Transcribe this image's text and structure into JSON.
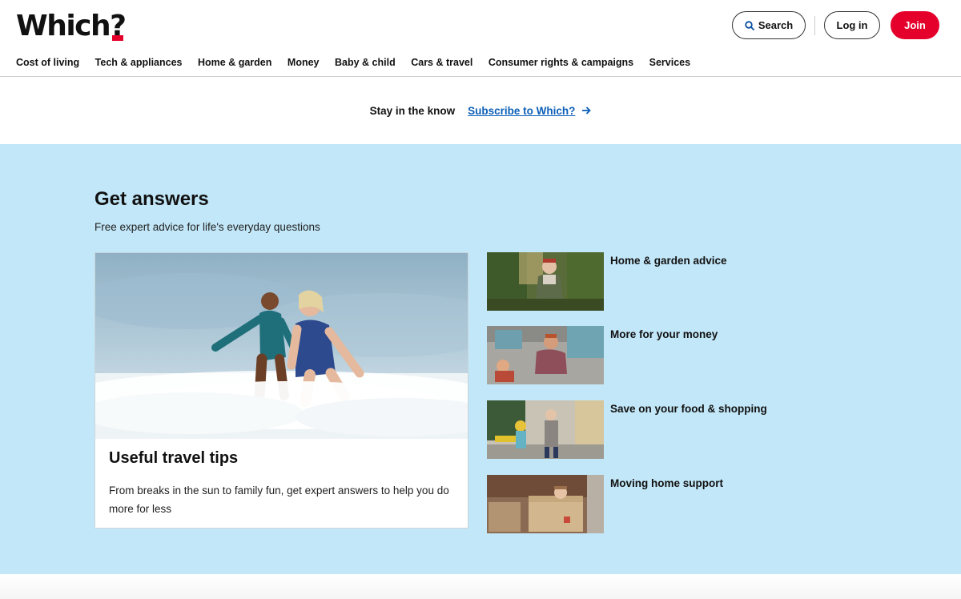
{
  "brand": {
    "name": "Which",
    "mark": "?",
    "accent": "#e4002b"
  },
  "header": {
    "search_label": "Search",
    "login_label": "Log in",
    "join_label": "Join"
  },
  "nav": [
    "Cost of living",
    "Tech & appliances",
    "Home & garden",
    "Money",
    "Baby & child",
    "Cars & travel",
    "Consumer rights & campaigns",
    "Services"
  ],
  "subscribe": {
    "text": "Stay in the know",
    "link": "Subscribe to Which?"
  },
  "answers": {
    "title": "Get answers",
    "subtitle": "Free expert advice for life's everyday questions",
    "bg_color": "#c2e7f8",
    "feature": {
      "title": "Useful travel tips",
      "description": "From breaks in the sun to family fun, get expert answers to help you do more for less"
    },
    "items": [
      {
        "label": "Home & garden advice"
      },
      {
        "label": "More for your money"
      },
      {
        "label": "Save on your food & shopping"
      },
      {
        "label": "Moving home support"
      }
    ]
  }
}
